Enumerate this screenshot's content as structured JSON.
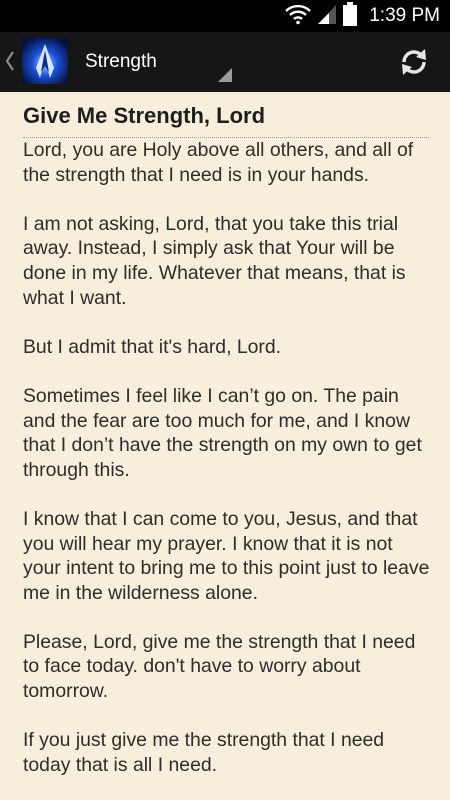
{
  "status_bar": {
    "time": "1:39 PM",
    "icons": [
      "wifi-icon",
      "cell-signal-icon",
      "battery-icon"
    ]
  },
  "action_bar": {
    "title": "Strength",
    "icons": [
      "up-caret-icon",
      "praying-hands-app-icon",
      "spinner-triangle-icon",
      "refresh-icon"
    ]
  },
  "prayer": {
    "title": "Give Me Strength, Lord",
    "paragraphs": [
      "Lord, you are Holy above all others, and all of the strength that I need is in your hands.",
      "I am not asking, Lord, that you take this trial away. Instead, I simply ask that Your will be done in my life. Whatever that means, that is what I want.",
      "But I admit that it's hard, Lord.",
      "Sometimes I feel like I can’t go on. The pain and the fear are too much for me, and I know that I don’t have the strength on my own to get through this.",
      "I know that I can come to you, Jesus, and that you will hear my prayer. I know that it is not your intent to bring me to this point just to leave me in the wilderness alone.",
      "Please, Lord, give me the strength that I need to face today. don't have to worry about tomorrow.",
      "If you just give me the strength that I need today that is all I need."
    ]
  },
  "colors": {
    "background": "#f7eedb",
    "action_bar": "#161616",
    "text": "#2d2d2d"
  }
}
